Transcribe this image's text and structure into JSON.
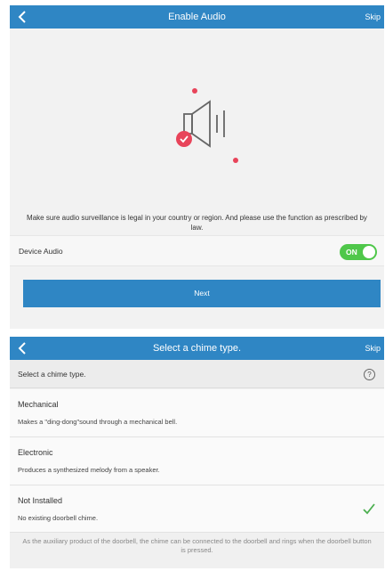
{
  "screen1": {
    "topbar": {
      "back_icon": "chevron-left-icon",
      "title": "Enable Audio",
      "skip": "Skip"
    },
    "illustration_icon": "speaker-icon",
    "notice": "Make sure audio surveillance is legal in your country or region. And please use the function as prescribed by law.",
    "device_audio": {
      "label": "Device Audio",
      "toggle_text": "ON",
      "enabled": true
    },
    "next_button": "Next"
  },
  "screen2": {
    "topbar": {
      "back_icon": "chevron-left-icon",
      "title": "Select a chime type.",
      "skip": "Skip"
    },
    "header_label": "Select a chime type.",
    "help_icon": "?",
    "options": [
      {
        "name": "Mechanical",
        "desc": "Makes a \"ding-dong\"sound through a mechanical bell.",
        "selected": false
      },
      {
        "name": "Electronic",
        "desc": "Produces a synthesized melody from a speaker.",
        "selected": false
      },
      {
        "name": "Not Installed",
        "desc": "No existing doorbell chime.",
        "selected": true
      }
    ],
    "footnote": "As the auxiliary product of the doorbell, the chime can be connected to the doorbell and rings when the doorbell button is pressed."
  },
  "colors": {
    "primary": "#2f86c4",
    "toggle_on": "#4fc74a",
    "accent_red": "#e8445a",
    "check_green": "#4caf50"
  }
}
